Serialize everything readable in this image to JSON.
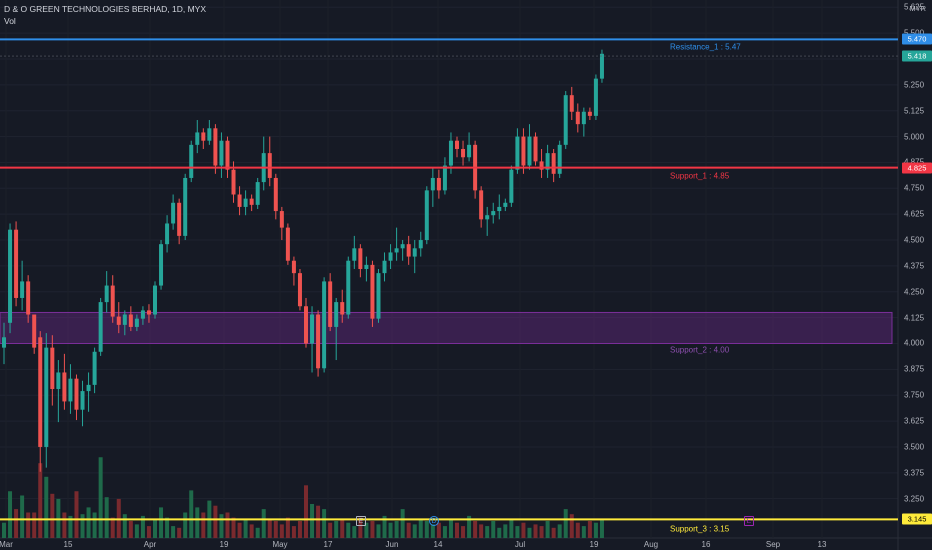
{
  "header": {
    "title": "D & O GREEN TECHNOLOGIES BERHAD, 1D, MYX",
    "volume_label": "Vol"
  },
  "colors": {
    "background": "#161a25",
    "up": "#26a69a",
    "down": "#ef5350",
    "up_volume": "#1f6a4a",
    "down_volume": "#7a2a2e",
    "resistance": "#2f8ee8",
    "support_1": "#f23645",
    "support_2": "#7b2f9a",
    "support_3": "#ffeb3b"
  },
  "chart_data": {
    "type": "candlestick",
    "title": "D & O GREEN TECHNOLOGIES BERHAD, 1D, MYX",
    "currency": "MYR",
    "ylim": [
      3.06,
      5.66
    ],
    "y_ticks": [
      "5.625",
      "5.500",
      "5.375",
      "5.250",
      "5.125",
      "5.000",
      "4.875",
      "4.750",
      "4.625",
      "4.500",
      "4.375",
      "4.250",
      "4.125",
      "4.000",
      "3.875",
      "3.750",
      "3.625",
      "3.500",
      "3.375",
      "3.250"
    ],
    "x_ticks": [
      "Mar",
      "15",
      "Apr",
      "19",
      "May",
      "17",
      "Jun",
      "14",
      "Jul",
      "19",
      "Aug",
      "16",
      "Sep",
      "13"
    ],
    "levels": [
      {
        "label": "Resistance_1 : 5.47",
        "value": 5.47,
        "tag": "5.470",
        "color": "#2f8ee8"
      },
      {
        "label": "Support_1 : 4.85",
        "value": 4.85,
        "tag": "4.825",
        "color": "#f23645"
      },
      {
        "label": "Support_3 : 3.15",
        "value": 3.15,
        "tag": "3.145",
        "color": "#ffeb3b"
      }
    ],
    "zone": {
      "label": "Support_2 : 4.00",
      "low": 4.0,
      "high": 4.15,
      "color": "#7b2f9a"
    },
    "last_price_tag": "5.418",
    "candles": [
      {
        "o": 3.98,
        "h": 4.1,
        "l": 3.9,
        "c": 4.03
      },
      {
        "o": 4.1,
        "h": 4.58,
        "l": 4.05,
        "c": 4.55
      },
      {
        "o": 4.55,
        "h": 4.59,
        "l": 4.18,
        "c": 4.22
      },
      {
        "o": 4.22,
        "h": 4.4,
        "l": 4.16,
        "c": 4.3
      },
      {
        "o": 4.3,
        "h": 4.33,
        "l": 4.1,
        "c": 4.14
      },
      {
        "o": 4.14,
        "h": 4.14,
        "l": 3.95,
        "c": 3.98
      },
      {
        "o": 4.03,
        "h": 4.06,
        "l": 3.38,
        "c": 3.5
      },
      {
        "o": 3.5,
        "h": 4.05,
        "l": 3.4,
        "c": 3.98
      },
      {
        "o": 3.98,
        "h": 4.04,
        "l": 3.7,
        "c": 3.78
      },
      {
        "o": 3.78,
        "h": 3.92,
        "l": 3.62,
        "c": 3.86
      },
      {
        "o": 3.86,
        "h": 3.95,
        "l": 3.68,
        "c": 3.72
      },
      {
        "o": 3.72,
        "h": 3.9,
        "l": 3.66,
        "c": 3.83
      },
      {
        "o": 3.83,
        "h": 3.85,
        "l": 3.63,
        "c": 3.68
      },
      {
        "o": 3.68,
        "h": 3.82,
        "l": 3.6,
        "c": 3.77
      },
      {
        "o": 3.77,
        "h": 3.86,
        "l": 3.67,
        "c": 3.8
      },
      {
        "o": 3.8,
        "h": 3.98,
        "l": 3.76,
        "c": 3.96
      },
      {
        "o": 3.96,
        "h": 4.22,
        "l": 3.94,
        "c": 4.2
      },
      {
        "o": 4.2,
        "h": 4.35,
        "l": 4.15,
        "c": 4.28
      },
      {
        "o": 4.28,
        "h": 4.33,
        "l": 4.1,
        "c": 4.13
      },
      {
        "o": 4.13,
        "h": 4.2,
        "l": 4.05,
        "c": 4.09
      },
      {
        "o": 4.09,
        "h": 4.16,
        "l": 4.04,
        "c": 4.14
      },
      {
        "o": 4.14,
        "h": 4.18,
        "l": 4.06,
        "c": 4.08
      },
      {
        "o": 4.08,
        "h": 4.14,
        "l": 4.06,
        "c": 4.12
      },
      {
        "o": 4.12,
        "h": 4.18,
        "l": 4.09,
        "c": 4.16
      },
      {
        "o": 4.16,
        "h": 4.19,
        "l": 4.1,
        "c": 4.14
      },
      {
        "o": 4.14,
        "h": 4.3,
        "l": 4.12,
        "c": 4.28
      },
      {
        "o": 4.28,
        "h": 4.5,
        "l": 4.26,
        "c": 4.48
      },
      {
        "o": 4.48,
        "h": 4.62,
        "l": 4.44,
        "c": 4.58
      },
      {
        "o": 4.58,
        "h": 4.72,
        "l": 4.55,
        "c": 4.68
      },
      {
        "o": 4.68,
        "h": 4.7,
        "l": 4.48,
        "c": 4.52
      },
      {
        "o": 4.52,
        "h": 4.82,
        "l": 4.5,
        "c": 4.8
      },
      {
        "o": 4.8,
        "h": 4.98,
        "l": 4.78,
        "c": 4.96
      },
      {
        "o": 4.96,
        "h": 5.08,
        "l": 4.92,
        "c": 5.02
      },
      {
        "o": 5.02,
        "h": 5.04,
        "l": 4.94,
        "c": 4.98
      },
      {
        "o": 4.98,
        "h": 5.08,
        "l": 4.96,
        "c": 5.04
      },
      {
        "o": 5.04,
        "h": 5.06,
        "l": 4.82,
        "c": 4.86
      },
      {
        "o": 4.86,
        "h": 5.02,
        "l": 4.8,
        "c": 4.98
      },
      {
        "o": 4.98,
        "h": 5.0,
        "l": 4.8,
        "c": 4.84
      },
      {
        "o": 4.84,
        "h": 4.88,
        "l": 4.68,
        "c": 4.72
      },
      {
        "o": 4.72,
        "h": 4.76,
        "l": 4.62,
        "c": 4.66
      },
      {
        "o": 4.66,
        "h": 4.74,
        "l": 4.62,
        "c": 4.7
      },
      {
        "o": 4.7,
        "h": 4.72,
        "l": 4.64,
        "c": 4.67
      },
      {
        "o": 4.67,
        "h": 4.8,
        "l": 4.65,
        "c": 4.78
      },
      {
        "o": 4.78,
        "h": 5.0,
        "l": 4.74,
        "c": 4.92
      },
      {
        "o": 4.92,
        "h": 5.0,
        "l": 4.76,
        "c": 4.8
      },
      {
        "o": 4.8,
        "h": 4.82,
        "l": 4.6,
        "c": 4.64
      },
      {
        "o": 4.64,
        "h": 4.66,
        "l": 4.5,
        "c": 4.56
      },
      {
        "o": 4.56,
        "h": 4.58,
        "l": 4.38,
        "c": 4.4
      },
      {
        "o": 4.4,
        "h": 4.42,
        "l": 4.28,
        "c": 4.34
      },
      {
        "o": 4.34,
        "h": 4.36,
        "l": 4.16,
        "c": 4.18
      },
      {
        "o": 4.18,
        "h": 4.22,
        "l": 3.98,
        "c": 4.0
      },
      {
        "o": 4.0,
        "h": 4.18,
        "l": 3.86,
        "c": 4.14
      },
      {
        "o": 4.14,
        "h": 4.16,
        "l": 3.84,
        "c": 3.88
      },
      {
        "o": 3.88,
        "h": 4.32,
        "l": 3.86,
        "c": 4.3
      },
      {
        "o": 4.3,
        "h": 4.34,
        "l": 4.06,
        "c": 4.08
      },
      {
        "o": 4.08,
        "h": 4.22,
        "l": 3.92,
        "c": 4.2
      },
      {
        "o": 4.2,
        "h": 4.26,
        "l": 4.1,
        "c": 4.14
      },
      {
        "o": 4.14,
        "h": 4.42,
        "l": 4.12,
        "c": 4.4
      },
      {
        "o": 4.4,
        "h": 4.52,
        "l": 4.36,
        "c": 4.46
      },
      {
        "o": 4.46,
        "h": 4.48,
        "l": 4.32,
        "c": 4.36
      },
      {
        "o": 4.36,
        "h": 4.42,
        "l": 4.3,
        "c": 4.38
      },
      {
        "o": 4.38,
        "h": 4.4,
        "l": 4.08,
        "c": 4.12
      },
      {
        "o": 4.12,
        "h": 4.36,
        "l": 4.1,
        "c": 4.34
      },
      {
        "o": 4.34,
        "h": 4.44,
        "l": 4.3,
        "c": 4.4
      },
      {
        "o": 4.4,
        "h": 4.48,
        "l": 4.36,
        "c": 4.44
      },
      {
        "o": 4.44,
        "h": 4.56,
        "l": 4.4,
        "c": 4.46
      },
      {
        "o": 4.46,
        "h": 4.5,
        "l": 4.4,
        "c": 4.48
      },
      {
        "o": 4.48,
        "h": 4.52,
        "l": 4.38,
        "c": 4.42
      },
      {
        "o": 4.42,
        "h": 4.5,
        "l": 4.34,
        "c": 4.46
      },
      {
        "o": 4.46,
        "h": 4.54,
        "l": 4.42,
        "c": 4.5
      },
      {
        "o": 4.5,
        "h": 4.76,
        "l": 4.48,
        "c": 4.74
      },
      {
        "o": 4.74,
        "h": 4.85,
        "l": 4.66,
        "c": 4.8
      },
      {
        "o": 4.8,
        "h": 4.84,
        "l": 4.7,
        "c": 4.74
      },
      {
        "o": 4.74,
        "h": 4.9,
        "l": 4.72,
        "c": 4.86
      },
      {
        "o": 4.86,
        "h": 5.02,
        "l": 4.82,
        "c": 4.98
      },
      {
        "o": 4.98,
        "h": 5.0,
        "l": 4.9,
        "c": 4.94
      },
      {
        "o": 4.94,
        "h": 4.98,
        "l": 4.86,
        "c": 4.9
      },
      {
        "o": 4.9,
        "h": 5.02,
        "l": 4.88,
        "c": 4.96
      },
      {
        "o": 4.96,
        "h": 4.98,
        "l": 4.7,
        "c": 4.74
      },
      {
        "o": 4.74,
        "h": 4.76,
        "l": 4.56,
        "c": 4.6
      },
      {
        "o": 4.6,
        "h": 4.66,
        "l": 4.52,
        "c": 4.62
      },
      {
        "o": 4.62,
        "h": 4.68,
        "l": 4.58,
        "c": 4.64
      },
      {
        "o": 4.64,
        "h": 4.72,
        "l": 4.6,
        "c": 4.66
      },
      {
        "o": 4.66,
        "h": 4.7,
        "l": 4.64,
        "c": 4.68
      },
      {
        "o": 4.68,
        "h": 4.86,
        "l": 4.66,
        "c": 4.84
      },
      {
        "o": 4.84,
        "h": 5.04,
        "l": 4.82,
        "c": 5.0
      },
      {
        "o": 5.0,
        "h": 5.04,
        "l": 4.82,
        "c": 4.86
      },
      {
        "o": 4.86,
        "h": 5.06,
        "l": 4.84,
        "c": 5.0
      },
      {
        "o": 5.0,
        "h": 5.02,
        "l": 4.86,
        "c": 4.88
      },
      {
        "o": 4.88,
        "h": 4.94,
        "l": 4.8,
        "c": 4.84
      },
      {
        "o": 4.84,
        "h": 4.96,
        "l": 4.8,
        "c": 4.92
      },
      {
        "o": 4.92,
        "h": 4.94,
        "l": 4.78,
        "c": 4.82
      },
      {
        "o": 4.82,
        "h": 4.98,
        "l": 4.8,
        "c": 4.96
      },
      {
        "o": 4.96,
        "h": 5.22,
        "l": 4.94,
        "c": 5.2
      },
      {
        "o": 5.2,
        "h": 5.24,
        "l": 5.08,
        "c": 5.12
      },
      {
        "o": 5.12,
        "h": 5.16,
        "l": 5.02,
        "c": 5.06
      },
      {
        "o": 5.06,
        "h": 5.14,
        "l": 5.0,
        "c": 5.12
      },
      {
        "o": 5.12,
        "h": 5.14,
        "l": 5.08,
        "c": 5.1
      },
      {
        "o": 5.1,
        "h": 5.3,
        "l": 5.08,
        "c": 5.28
      },
      {
        "o": 5.28,
        "h": 5.42,
        "l": 5.26,
        "c": 5.4
      }
    ],
    "volumes": [
      0.18,
      0.55,
      0.34,
      0.5,
      0.3,
      0.3,
      0.88,
      0.72,
      0.52,
      0.46,
      0.3,
      0.26,
      0.55,
      0.28,
      0.36,
      0.3,
      0.95,
      0.48,
      0.24,
      0.46,
      0.28,
      0.2,
      0.16,
      0.26,
      0.14,
      0.22,
      0.36,
      0.24,
      0.14,
      0.12,
      0.3,
      0.56,
      0.36,
      0.3,
      0.44,
      0.38,
      0.28,
      0.3,
      0.24,
      0.18,
      0.22,
      0.16,
      0.12,
      0.34,
      0.22,
      0.2,
      0.16,
      0.24,
      0.14,
      0.2,
      0.62,
      0.4,
      0.38,
      0.34,
      0.18,
      0.2,
      0.22,
      0.18,
      0.14,
      0.24,
      0.18,
      0.2,
      0.16,
      0.26,
      0.18,
      0.2,
      0.34,
      0.18,
      0.16,
      0.22,
      0.2,
      0.16,
      0.18,
      0.14,
      0.22,
      0.18,
      0.14,
      0.26,
      0.2,
      0.16,
      0.14,
      0.2,
      0.12,
      0.16,
      0.22,
      0.14,
      0.18,
      0.12,
      0.16,
      0.14,
      0.2,
      0.12,
      0.16,
      0.34,
      0.28,
      0.18,
      0.14,
      0.2,
      0.18,
      0.22
    ],
    "events": [
      "E",
      "D",
      "E"
    ]
  }
}
